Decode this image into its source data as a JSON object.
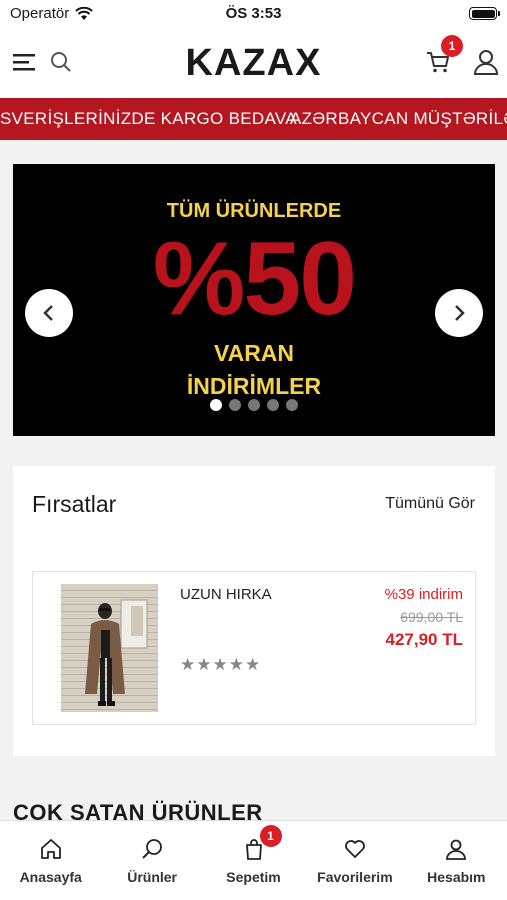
{
  "status_bar": {
    "carrier": "Operatör",
    "time": "ÖS 3:53"
  },
  "header": {
    "logo": "KAZAX",
    "cart_count": "1"
  },
  "ticker": {
    "items": [
      "SVERİŞLERİNİZDE KARGO BEDAVA",
      "AZƏRBAYCAN MÜŞTƏRİLƏR"
    ]
  },
  "banner": {
    "line1": "TÜM ÜRÜNLERDE",
    "big": "%50",
    "line2": "VARAN",
    "line3": "İNDİRİMLER",
    "dot_count": 5,
    "active_dot": 0
  },
  "deals": {
    "title": "Fırsatlar",
    "see_all": "Tümünü Gör",
    "product": {
      "name": "UZUN HIRKA",
      "discount": "%39 indirim",
      "old_price": "699,00 TL",
      "new_price": "427,90 TL",
      "stars": "★★★★★",
      "rating": 0
    }
  },
  "section2_title": "ÇOK SATAN ÜRÜNLER",
  "tabbar": {
    "items": [
      {
        "label": "Anasayfa",
        "icon": "home-icon"
      },
      {
        "label": "Ürünler",
        "icon": "search-icon"
      },
      {
        "label": "Sepetim",
        "icon": "shopping-bag-icon",
        "badge": "1"
      },
      {
        "label": "Favorilerim",
        "icon": "heart-icon"
      },
      {
        "label": "Hesabım",
        "icon": "user-icon"
      }
    ]
  },
  "colors": {
    "accent": "#d91e26",
    "ticker_bg": "#b4171f",
    "banner_yellow": "#f6d24a"
  }
}
